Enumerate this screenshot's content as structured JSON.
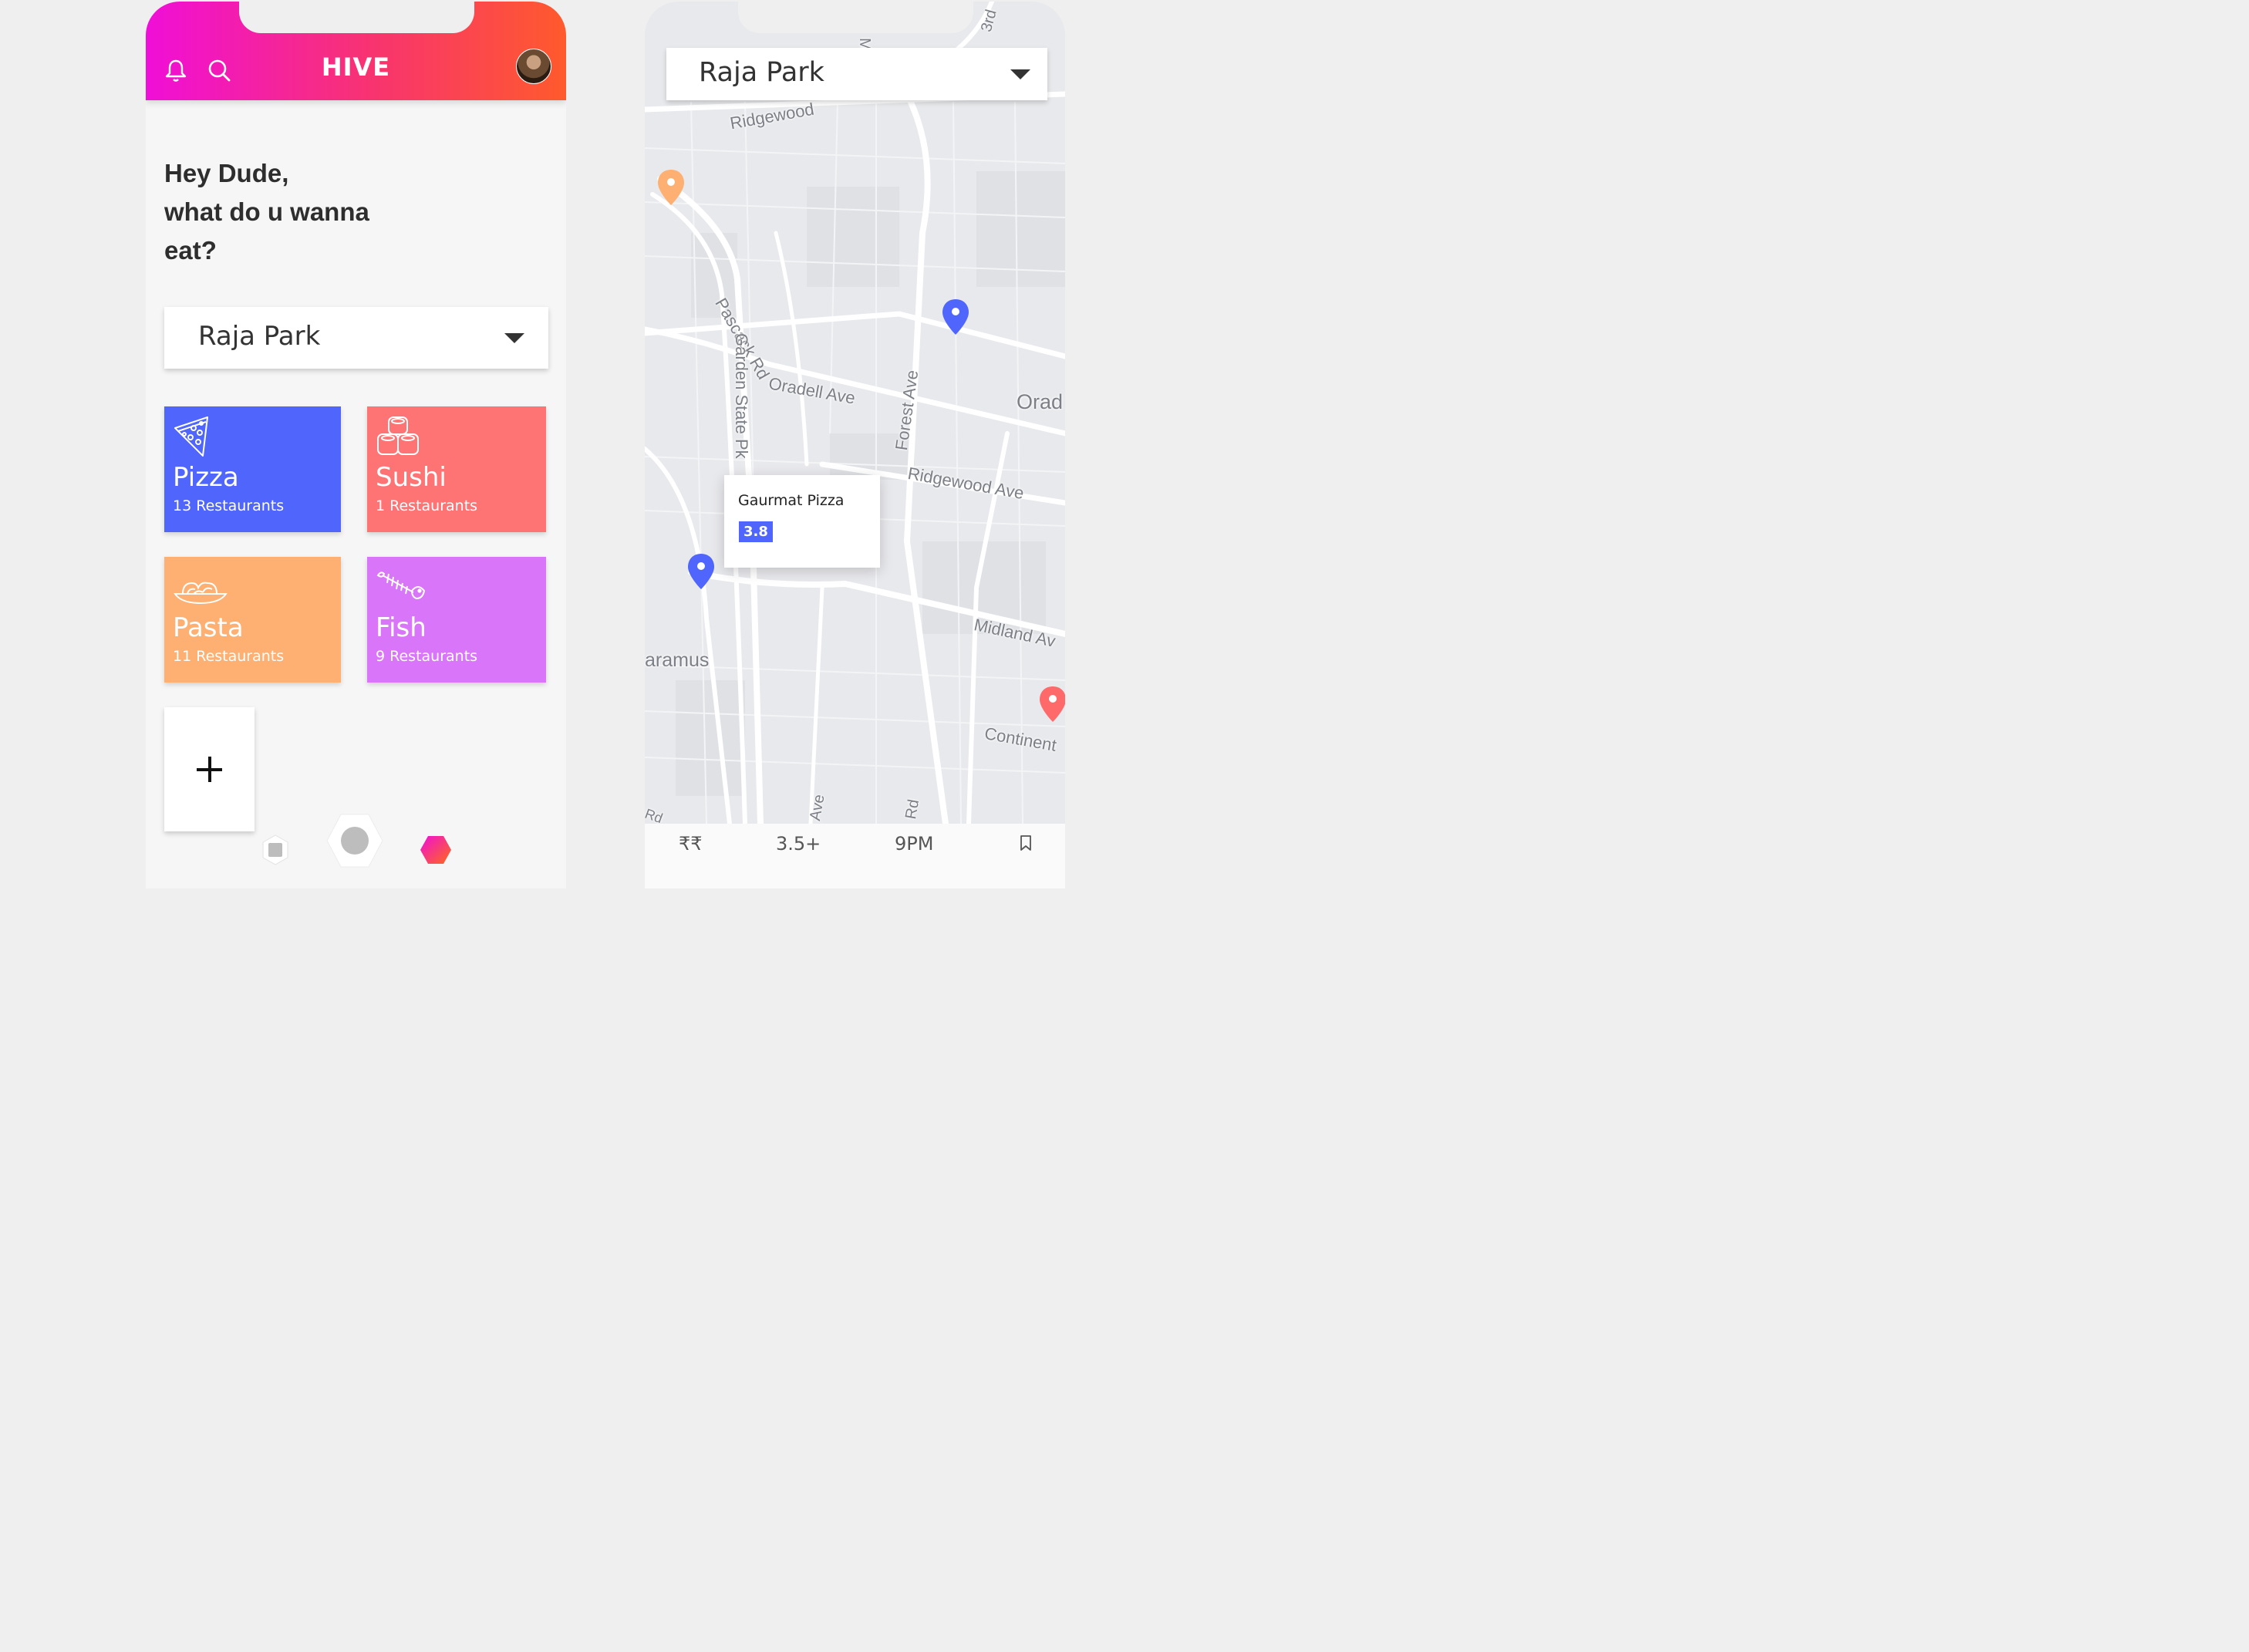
{
  "home": {
    "app_title": "HIVE",
    "greeting": [
      "Hey Dude,",
      "what do u wanna",
      "eat?"
    ],
    "location": "Raja Park",
    "gradient": [
      "#f00ed8",
      "#ff5a2c"
    ],
    "categories": [
      {
        "name": "Pizza",
        "count": "13 Restaurants",
        "color": "#4f65fb",
        "icon": "pizza-icon"
      },
      {
        "name": "Sushi",
        "count": "1 Restaurants",
        "color": "#fe7373",
        "icon": "sushi-icon"
      },
      {
        "name": "Pasta",
        "count": "11 Restaurants",
        "color": "#fdb072",
        "icon": "pasta-icon"
      },
      {
        "name": "Fish",
        "count": "9 Restaurants",
        "color": "#d975f8",
        "icon": "fish-icon"
      }
    ],
    "add_label": "+"
  },
  "map": {
    "location": "Raja Park",
    "labels": {
      "ridgewood_top": "Ridgewood",
      "pascack": "Pascack Rd",
      "garden_state": "Garden State Pk",
      "oradell": "Oradell Ave",
      "forest": "Forest Ave",
      "orad": "Orad",
      "ridgewood_ave": "Ridgewood Ave",
      "midland": "Midland Av",
      "paramus": "aramus",
      "continental": "Continent",
      "third": "3rd",
      "m": "M",
      "ave_bottom": "Ave",
      "rd_bottom": "Rd",
      "rd_left": "Rd"
    },
    "popup": {
      "name": "Gaurmat Pizza",
      "rating": "3.8"
    },
    "pins": [
      {
        "color": "#fdb072"
      },
      {
        "color": "#4f65fb"
      },
      {
        "color": "#4f65fb"
      },
      {
        "color": "#fe6a6a"
      }
    ],
    "filters": {
      "price": "₹₹",
      "rating": "3.5+",
      "time": "9PM",
      "bookmark_icon": "bookmark-icon"
    }
  }
}
